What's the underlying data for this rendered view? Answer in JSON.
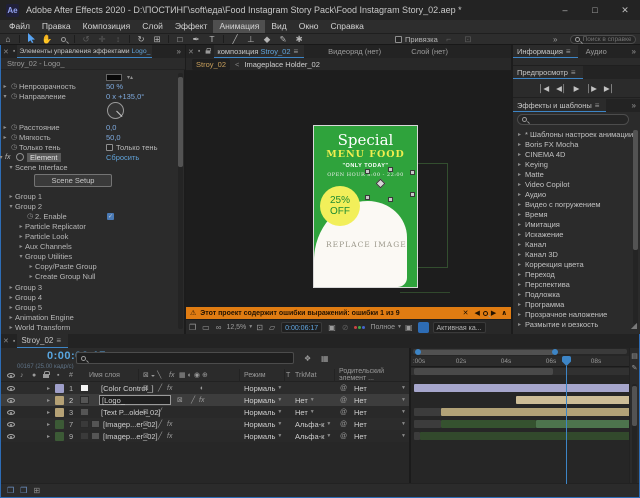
{
  "window": {
    "title": "Adobe After Effects 2020 - D:\\ПОСТИНГ\\soft\\еда\\Food Instagram Story Pack\\Food Instagram Story_02.aep *",
    "minimize": "–",
    "maximize": "□",
    "close": "✕"
  },
  "menu": {
    "items": [
      "Файл",
      "Правка",
      "Композиция",
      "Слой",
      "Эффект",
      "Анимация",
      "Вид",
      "Окно",
      "Справка"
    ],
    "active": "Анимация"
  },
  "toolbar": {
    "snap_label": "Привязка",
    "overflow": "»",
    "search_placeholder": "Поиск в справке"
  },
  "effect_controls": {
    "tab_close": "✕",
    "tab_title": "Элементы управления эффектами",
    "tab_target": "Logo_",
    "overflow": "»",
    "subtitle": "Stroy_02 - Logo_",
    "opacity_label": "Непрозрачность",
    "opacity_value": "50 %",
    "direction_label": "Направление",
    "direction_value": "0 x +135,0°",
    "distance_label": "Расстояние",
    "distance_value": "0,0",
    "softness_label": "Мягкость",
    "softness_value": "50,0",
    "shadow_only_label": "Только тень",
    "shadow_only_checkbox": "Только тень",
    "element_label": "Element",
    "element_fx": "fx",
    "element_reset": "Сбросить",
    "scene_interface_label": "Scene Interface",
    "scene_setup_button": "Scene Setup",
    "group1": "Group 1",
    "group2": "Group 2",
    "enable_label": "2. Enable",
    "enable_check": "✓",
    "particle_replicator": "Particle Replicator",
    "particle_look": "Particle Look",
    "aux_channels": "Aux Channels",
    "group_utilities": "Group Utilities",
    "copy_paste_group": "Copy/Paste Group",
    "create_group_null": "Create Group Null",
    "group3": "Group 3",
    "group4": "Group 4",
    "group5": "Group 5",
    "animation_engine": "Animation Engine",
    "world_transform": "World Transform"
  },
  "comp": {
    "tab_close": "✕",
    "tab_label": "композиция",
    "tab_name": "Stroy_02",
    "tab_menu": "≡",
    "tab_footage": "Видеоряд  (нет)",
    "tab_layer": "Слой  (нет)",
    "breadcrumb_comp": "Stroy_02",
    "breadcrumb_sep": "<",
    "breadcrumb_current": "Imageplace Holder_02",
    "poster": {
      "title": "Special",
      "menu_line": "MENU FOOD",
      "tagline": "\"ONLY TODAY\"",
      "hours": "OPEN HOUR  8:00 - 22:00",
      "badge_top": "25%",
      "badge_bottom": "OFF",
      "replace_label": "REPLACE IMAGE",
      "green": "#2fa33c",
      "yellow": "#f0ee4e",
      "badge_yellow": "#f2ef5a"
    },
    "warning": {
      "icon": "⚠",
      "text": "Этот проект содержит ошибки выражений: ошибки 1 из 9",
      "close": "✕",
      "prev": "◀",
      "next": "▶",
      "collapse": "∧"
    },
    "status": {
      "zoom": "12,5%",
      "timecode": "0:00:06:17",
      "quality": "Полное",
      "camera": "Активная ка..."
    }
  },
  "right": {
    "info_tab": "Информация",
    "audio_tab": "Аудио",
    "preview_tab": "Предпросмотр",
    "effects_tab": "Эффекты и шаблоны",
    "overflow": "»",
    "transport": [
      "│◀",
      "◀│",
      "▶",
      "│▶",
      "▶│"
    ]
  },
  "effects_panel": {
    "items": [
      "* Шаблоны настроек анимации",
      "Boris FX Mocha",
      "CINEMA 4D",
      "Keying",
      "Matte",
      "Video Copilot",
      "Аудио",
      "Видео с погружением",
      "Время",
      "Имитация",
      "Искажение",
      "Канал",
      "Канал 3D",
      "Коррекция цвета",
      "Переход",
      "Перспектива",
      "Подложка",
      "Программа",
      "Прозрачное наложение",
      "Размытие и резкость"
    ]
  },
  "timeline": {
    "tab": "Stroy_02",
    "timecode": "0:00:06:17",
    "frame_info": "00167 (25.00 кадр/с)",
    "col_name": "Имя слоя",
    "col_mode": "Режим",
    "col_t": "T",
    "col_trkmat": "TrkMat",
    "col_parent": "Родительский элемент ...",
    "ruler": [
      ":00s",
      "02s",
      "04s",
      "06s",
      "08s"
    ],
    "layers": [
      {
        "num": "1",
        "name": "[Color Control_]",
        "mode": "Нормаль",
        "trkmat": "",
        "parent": "Нет",
        "label_color": "#9e9ec9"
      },
      {
        "num": "2",
        "name": "[Logo_",
        "mode": "Нормаль",
        "trkmat": "Нет",
        "parent": "Нет",
        "label_color": "#b5a175"
      },
      {
        "num": "3",
        "name": "[Text P...older_02]",
        "mode": "Нормаль",
        "trkmat": "Нет",
        "parent": "Нет",
        "label_color": "#b5a175"
      },
      {
        "num": "7",
        "name": "[Imagep...er_02]",
        "mode": "Нормаль",
        "trkmat": "Альфа-к",
        "parent": "Нет",
        "label_color": "#3c5a36"
      },
      {
        "num": "9",
        "name": "[Imagep...er_02]",
        "mode": "Нормаль",
        "trkmat": "Альфа-к",
        "parent": "Нет",
        "label_color": "#3c5a36"
      }
    ]
  },
  "colors": {
    "accent_blue": "#3d85c6",
    "value_blue": "#7fabdf",
    "warning_orange": "#e07c12",
    "bar_lavender": "#a6a6cc",
    "bar_sand_light": "#cdbd97",
    "bar_sand": "#b2a277",
    "bar_green_dark": "#35522f",
    "bar_green": "#4d744d"
  }
}
